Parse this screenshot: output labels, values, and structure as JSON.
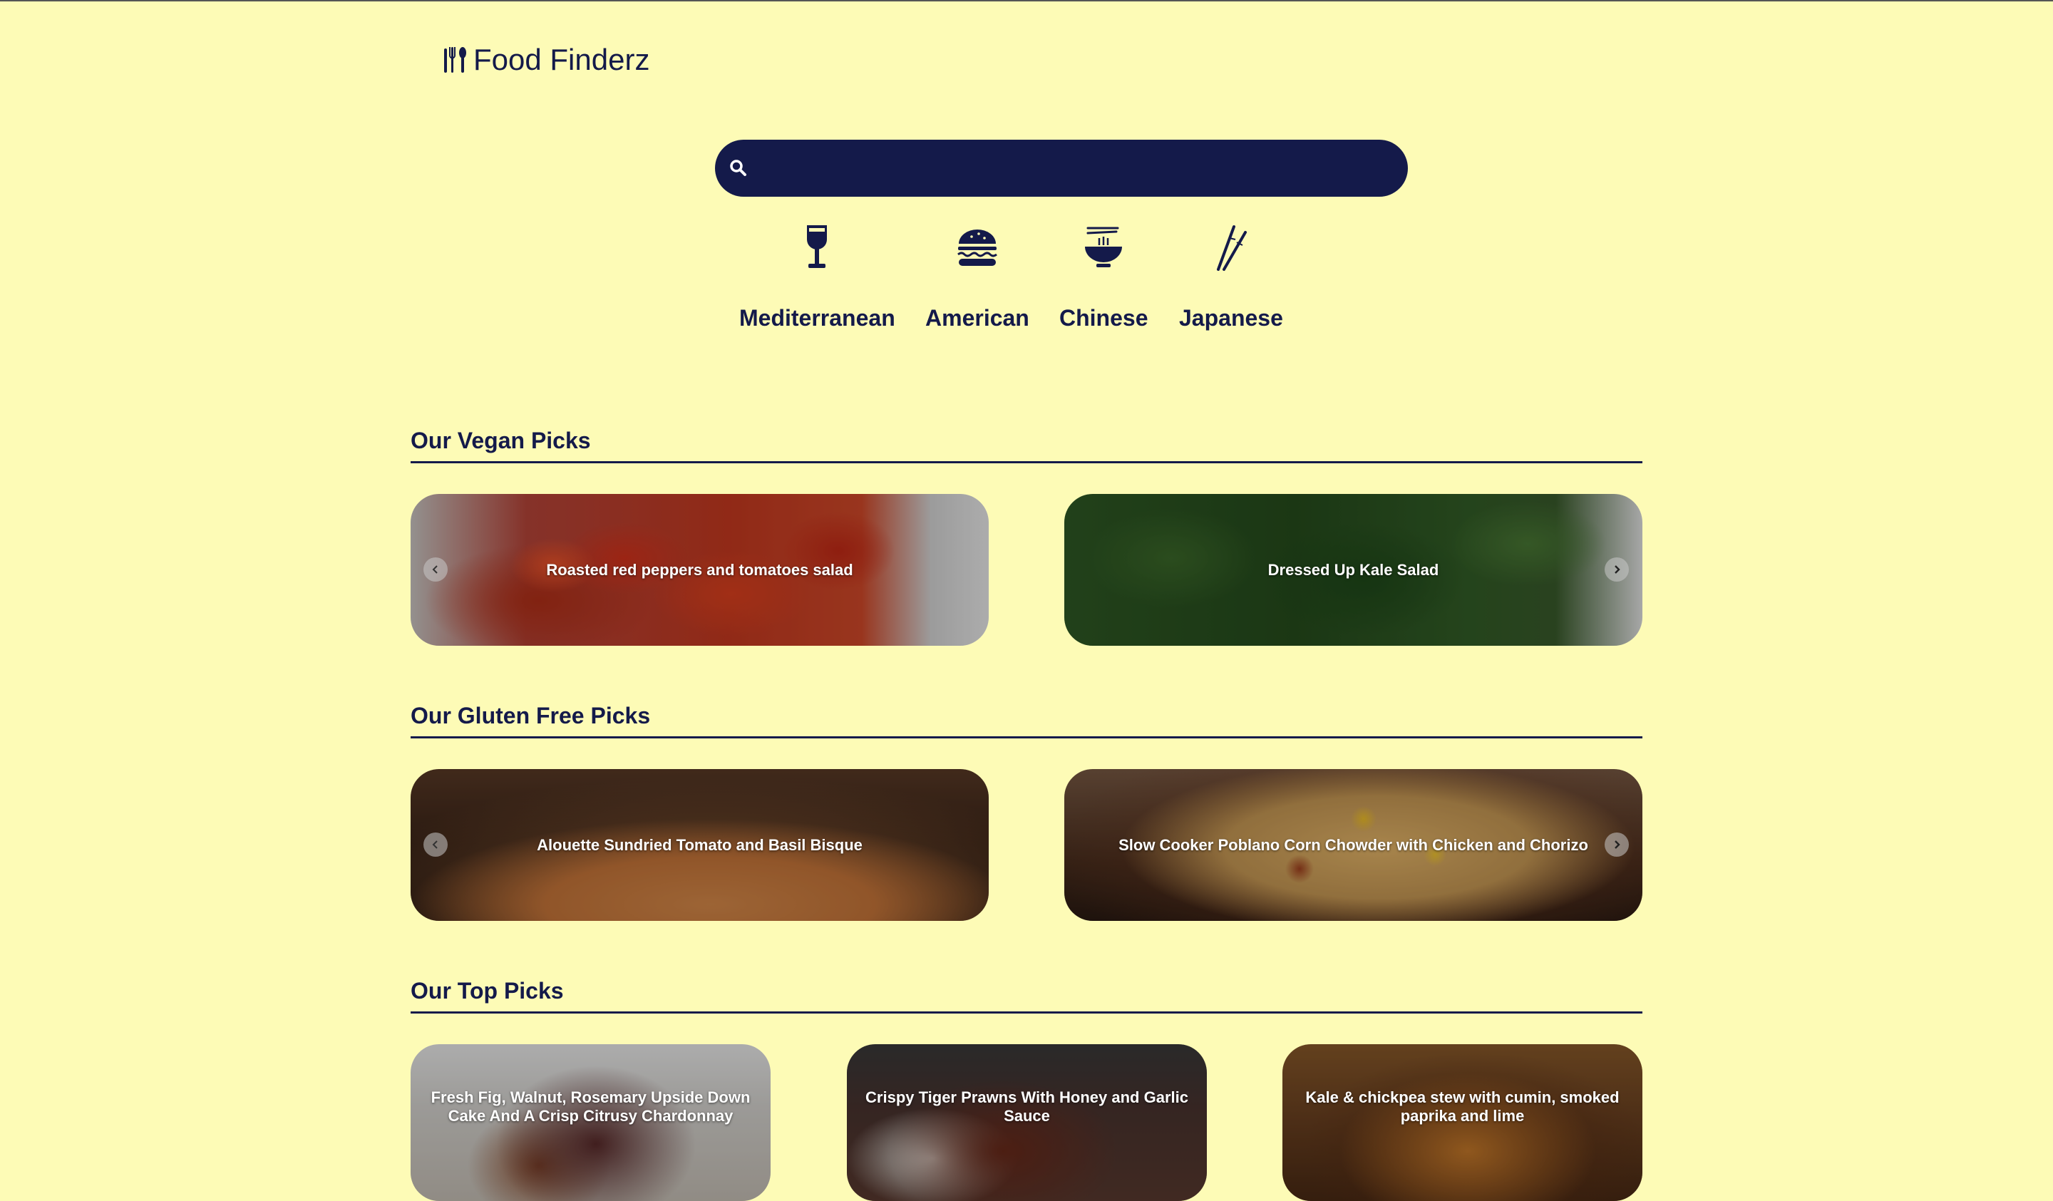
{
  "app": {
    "title": "Food Finderz"
  },
  "search": {
    "placeholder": "",
    "value": ""
  },
  "cuisines": [
    {
      "label": "Mediterranean",
      "icon": "wine-glass-icon"
    },
    {
      "label": "American",
      "icon": "burger-icon"
    },
    {
      "label": "Chinese",
      "icon": "noodle-bowl-icon"
    },
    {
      "label": "Japanese",
      "icon": "chopsticks-icon"
    }
  ],
  "sections": {
    "vegan": {
      "title": "Our Vegan Picks",
      "cards": [
        "Roasted red peppers and tomatoes salad",
        "Dressed Up Kale Salad"
      ]
    },
    "gluten_free": {
      "title": "Our Gluten Free Picks",
      "cards": [
        "Alouette Sundried Tomato and Basil Bisque",
        "Slow Cooker Poblano Corn Chowder with Chicken and Chorizo"
      ]
    },
    "top": {
      "title": "Our Top Picks",
      "cards": [
        "Fresh Fig, Walnut, Rosemary Upside Down Cake And A Crisp Citrusy Chardonnay",
        "Crispy Tiger Prawns With Honey and Garlic Sauce",
        "Kale & chickpea stew with cumin, smoked paprika and lime"
      ]
    }
  },
  "colors": {
    "background": "#fdfbb6",
    "primary": "#141a4a",
    "text_on_image": "#ffffff"
  }
}
